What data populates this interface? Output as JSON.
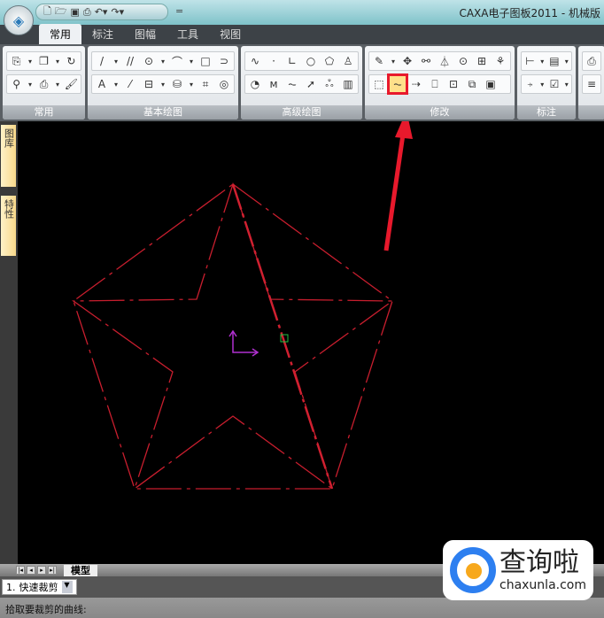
{
  "window": {
    "title": "CAXA电子图板2011 - 机械版"
  },
  "qat": {
    "icons": [
      "new-icon",
      "open-icon",
      "save-icon",
      "print-icon",
      "undo-icon",
      "redo-icon"
    ],
    "more": "="
  },
  "tabs": [
    "常用",
    "标注",
    "图幅",
    "工具",
    "视图"
  ],
  "ribbon": {
    "groups": [
      {
        "label": "常用",
        "row1": [
          "⎘",
          "▾",
          "❐",
          "▾",
          "↻"
        ],
        "row2": [
          "⚲",
          "▾",
          "⎙",
          "▾",
          "🖌"
        ]
      },
      {
        "label": "基本绘图",
        "row1": [
          "/",
          "▾",
          "//",
          "⊙",
          "▾",
          "⌒",
          "▾",
          "□",
          "⊃"
        ],
        "row2": [
          "A",
          "▾",
          "⁄",
          "⊟",
          "▾",
          "⛁",
          "▾",
          "⌗",
          "◎"
        ]
      },
      {
        "label": "高级绘图",
        "row1": [
          "∿",
          "·",
          "∟",
          "○",
          "⬠",
          "♙"
        ],
        "row2": [
          "◔",
          "ᴍ",
          "⏦",
          "➚",
          "ஃ",
          "▥"
        ]
      },
      {
        "label": "修改",
        "row1": [
          "✎",
          "▾",
          "✥",
          "⚯",
          "⏃",
          "⊙",
          "⊞",
          "⚘"
        ],
        "row2": [
          "⬚",
          "⏦",
          "⇢",
          "⎕",
          "⊡",
          "⧉",
          "▣"
        ]
      },
      {
        "label": "标注",
        "row1": [
          "⊢",
          "▾",
          "▤",
          "▾"
        ],
        "row2": [
          "⍆",
          "▾",
          "☑",
          "▾"
        ]
      },
      {
        "label": "",
        "row1": [
          "⎙"
        ],
        "row2": [
          "≡"
        ]
      }
    ],
    "highlighted": "quick-trim-icon"
  },
  "sidebar": {
    "tabs": [
      "图库",
      "特性"
    ]
  },
  "bottom": {
    "model_tab": "模型",
    "nav": [
      "|◂",
      "◂",
      "▸",
      "▸|"
    ]
  },
  "command": {
    "index": "1.",
    "value": "快速裁剪"
  },
  "status": {
    "prompt": "拾取要裁剪的曲线:"
  },
  "watermark": {
    "text": "查询啦",
    "url": "chaxunla.com"
  },
  "colors": {
    "drawing": "#c81e2e",
    "arrow": "#e8192c",
    "ucs": "#b030d0",
    "cursor": "#20c040"
  }
}
